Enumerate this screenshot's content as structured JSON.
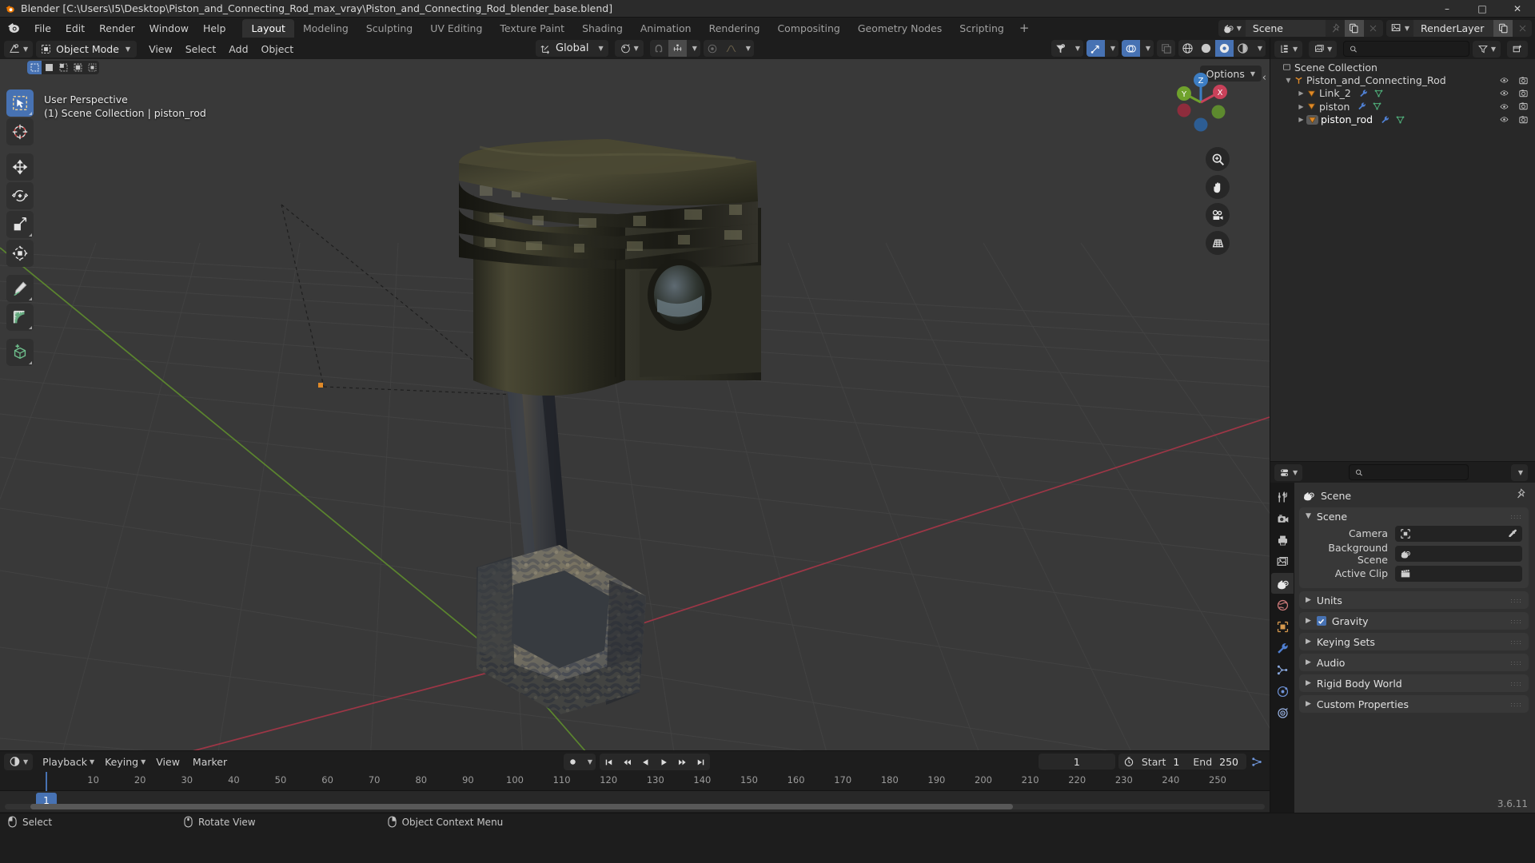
{
  "window": {
    "title": "Blender [C:\\Users\\I5\\Desktop\\Piston_and_Connecting_Rod_max_vray\\Piston_and_Connecting_Rod_blender_base.blend]",
    "minimize": "–",
    "maximize": "□",
    "close": "✕"
  },
  "topbar": {
    "menus": [
      "File",
      "Edit",
      "Render",
      "Window",
      "Help"
    ],
    "workspaces": [
      {
        "label": "Layout",
        "active": true
      },
      {
        "label": "Modeling",
        "active": false
      },
      {
        "label": "Sculpting",
        "active": false
      },
      {
        "label": "UV Editing",
        "active": false
      },
      {
        "label": "Texture Paint",
        "active": false
      },
      {
        "label": "Shading",
        "active": false
      },
      {
        "label": "Animation",
        "active": false
      },
      {
        "label": "Rendering",
        "active": false
      },
      {
        "label": "Compositing",
        "active": false
      },
      {
        "label": "Geometry Nodes",
        "active": false
      },
      {
        "label": "Scripting",
        "active": false
      }
    ],
    "add_workspace": "+",
    "scene_name": "Scene",
    "view_layer_name": "RenderLayer"
  },
  "viewport_header": {
    "editor_type_icon": "editor-type-3dview-icon",
    "mode": "Object Mode",
    "menus": [
      "View",
      "Select",
      "Add",
      "Object"
    ],
    "transform_orientation": "Global",
    "select_modes": [
      "tweak",
      "box-select",
      "circle-select",
      "lasso-select",
      "select-box-extend"
    ],
    "shading_modes": [
      "wireframe",
      "solid",
      "material-preview",
      "rendered"
    ],
    "active_shading": "material-preview"
  },
  "viewport": {
    "overlay_line1": "User Perspective",
    "overlay_line2": "(1) Scene Collection | piston_rod",
    "options_label": "Options",
    "gizmo_axes": [
      "X",
      "Y",
      "Z"
    ],
    "tools": [
      "tweak-tool",
      "cursor-tool",
      "move-tool",
      "rotate-tool",
      "scale-tool",
      "transform-tool",
      "annotate-tool",
      "measure-tool",
      "add-cube-tool"
    ]
  },
  "outliner": {
    "search_placeholder": "",
    "rows": [
      {
        "label": "Scene Collection",
        "indent": 0,
        "icon": "collection-icon",
        "disclosure": "",
        "selected": false,
        "has_visibility": false
      },
      {
        "label": "Piston_and_Connecting_Rod",
        "indent": 1,
        "icon": "empty-axes-icon",
        "disclosure": "▼",
        "selected": false,
        "has_visibility": true
      },
      {
        "label": "Link_2",
        "indent": 2,
        "icon": "mesh-object-icon",
        "disclosure": "▶",
        "selected": false,
        "has_visibility": true
      },
      {
        "label": "piston",
        "indent": 2,
        "icon": "mesh-object-icon",
        "disclosure": "▶",
        "selected": false,
        "has_visibility": true
      },
      {
        "label": "piston_rod",
        "indent": 2,
        "icon": "mesh-object-icon",
        "disclosure": "▶",
        "selected": true,
        "has_visibility": true
      }
    ]
  },
  "properties": {
    "search_placeholder": "",
    "breadcrumb": "Scene",
    "tabs": [
      "tool",
      "render",
      "output",
      "view-layer",
      "scene",
      "world",
      "object",
      "modifiers",
      "particles",
      "physics",
      "constraints"
    ],
    "active_tab": "scene",
    "panels": [
      {
        "title": "Scene",
        "expanded": true,
        "fields": [
          {
            "label": "Camera",
            "value": "",
            "icon": "camera-data-icon",
            "eyedropper": true
          },
          {
            "label": "Background Scene",
            "value": "",
            "icon": "scene-icon",
            "eyedropper": false
          },
          {
            "label": "Active Clip",
            "value": "",
            "icon": "movie-clip-icon",
            "eyedropper": false
          }
        ]
      },
      {
        "title": "Units",
        "expanded": false,
        "checkbox": null
      },
      {
        "title": "Gravity",
        "expanded": false,
        "checkbox": true
      },
      {
        "title": "Keying Sets",
        "expanded": false,
        "checkbox": null
      },
      {
        "title": "Audio",
        "expanded": false,
        "checkbox": null
      },
      {
        "title": "Rigid Body World",
        "expanded": false,
        "checkbox": null
      },
      {
        "title": "Custom Properties",
        "expanded": false,
        "checkbox": null
      }
    ],
    "version": "3.6.11"
  },
  "timeline": {
    "menus": [
      "Playback",
      "Keying",
      "View",
      "Marker"
    ],
    "current_frame": "1",
    "start_label": "Start",
    "start_value": "1",
    "end_label": "End",
    "end_value": "250",
    "ruler_ticks": [
      "10",
      "20",
      "30",
      "40",
      "50",
      "60",
      "70",
      "80",
      "90",
      "100",
      "110",
      "120",
      "130",
      "140",
      "150",
      "160",
      "170",
      "180",
      "190",
      "200",
      "210",
      "220",
      "230",
      "240",
      "250"
    ],
    "playhead_label": "1",
    "transport": [
      "jump-start-icon",
      "prev-keyframe-icon",
      "play-reverse-icon",
      "play-icon",
      "next-keyframe-icon",
      "jump-end-icon"
    ]
  },
  "statusbar": {
    "items": [
      {
        "mouse": "left-mouse-icon",
        "label": "Select"
      },
      {
        "mouse": "middle-mouse-icon",
        "label": "Rotate View"
      },
      {
        "mouse": "right-mouse-icon",
        "label": "Object Context Menu"
      }
    ]
  },
  "colors": {
    "accent_blue": "#4772b3",
    "viewport_bg": "#393939",
    "panel_bg": "#303030",
    "axis_x": "#c9415a",
    "axis_y": "#6fa22c",
    "axis_z": "#3d7ec4"
  }
}
